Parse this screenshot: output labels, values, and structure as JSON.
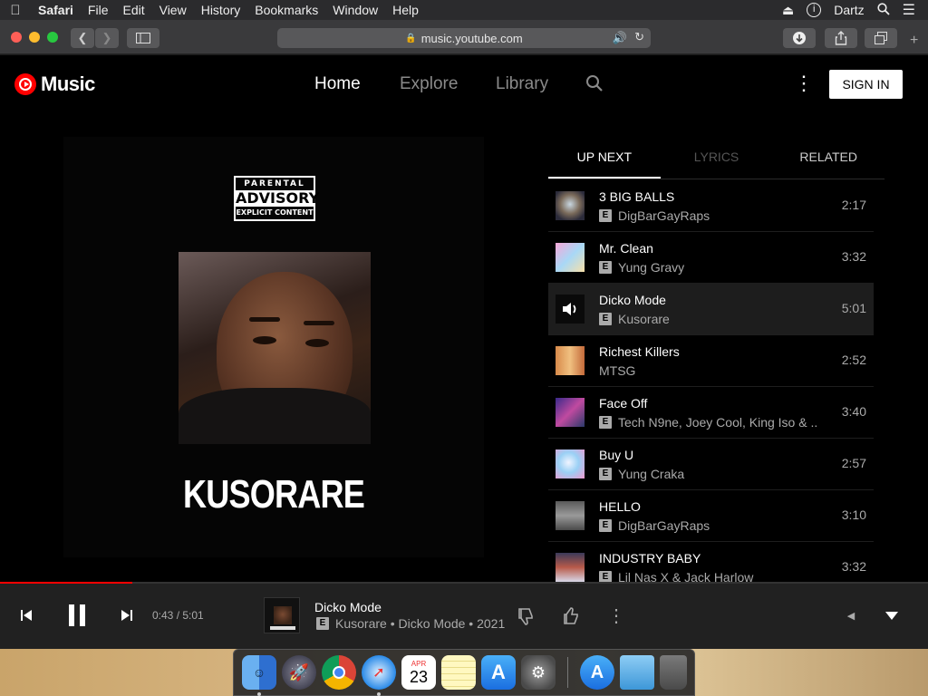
{
  "menubar": {
    "app": "Safari",
    "items": [
      "File",
      "Edit",
      "View",
      "History",
      "Bookmarks",
      "Window",
      "Help"
    ],
    "user": "Dartz"
  },
  "browser": {
    "url": "music.youtube.com"
  },
  "header": {
    "logo_text": "Music",
    "nav": [
      "Home",
      "Explore",
      "Library"
    ],
    "sign_in": "SIGN IN"
  },
  "album": {
    "advisory_top": "PARENTAL",
    "advisory_mid": "ADVISORY",
    "advisory_bottom": "EXPLICIT CONTENT",
    "artist_title": "KUSORARE"
  },
  "tabs": [
    "UP NEXT",
    "LYRICS",
    "RELATED"
  ],
  "queue": [
    {
      "title": "3 BIG BALLS",
      "artist": "DigBarGayRaps",
      "duration": "2:17",
      "explicit": true
    },
    {
      "title": "Mr. Clean",
      "artist": "Yung Gravy",
      "duration": "3:32",
      "explicit": true
    },
    {
      "title": "Dicko Mode",
      "artist": "Kusorare",
      "duration": "5:01",
      "explicit": true,
      "playing": true
    },
    {
      "title": "Richest Killers",
      "artist": "MTSG",
      "duration": "2:52",
      "explicit": false
    },
    {
      "title": "Face Off",
      "artist": "Tech N9ne, Joey Cool, King Iso & ...",
      "duration": "3:40",
      "explicit": true
    },
    {
      "title": "Buy U",
      "artist": "Yung Craka",
      "duration": "2:57",
      "explicit": true
    },
    {
      "title": "HELLO",
      "artist": "DigBarGayRaps",
      "duration": "3:10",
      "explicit": true
    },
    {
      "title": "INDUSTRY BABY",
      "artist": "Lil Nas X & Jack Harlow",
      "duration": "3:32",
      "explicit": true
    }
  ],
  "player": {
    "time": "0:43 / 5:01",
    "progress_fraction": 0.143,
    "title": "Dicko Mode",
    "subtitle": "Kusorare • Dicko Mode • 2021",
    "explicit": "E"
  },
  "dock": {
    "calendar_month": "APR",
    "calendar_day": "23"
  },
  "colors": {
    "accent": "#ff0000",
    "background": "#000000",
    "player_bar": "#212121"
  }
}
